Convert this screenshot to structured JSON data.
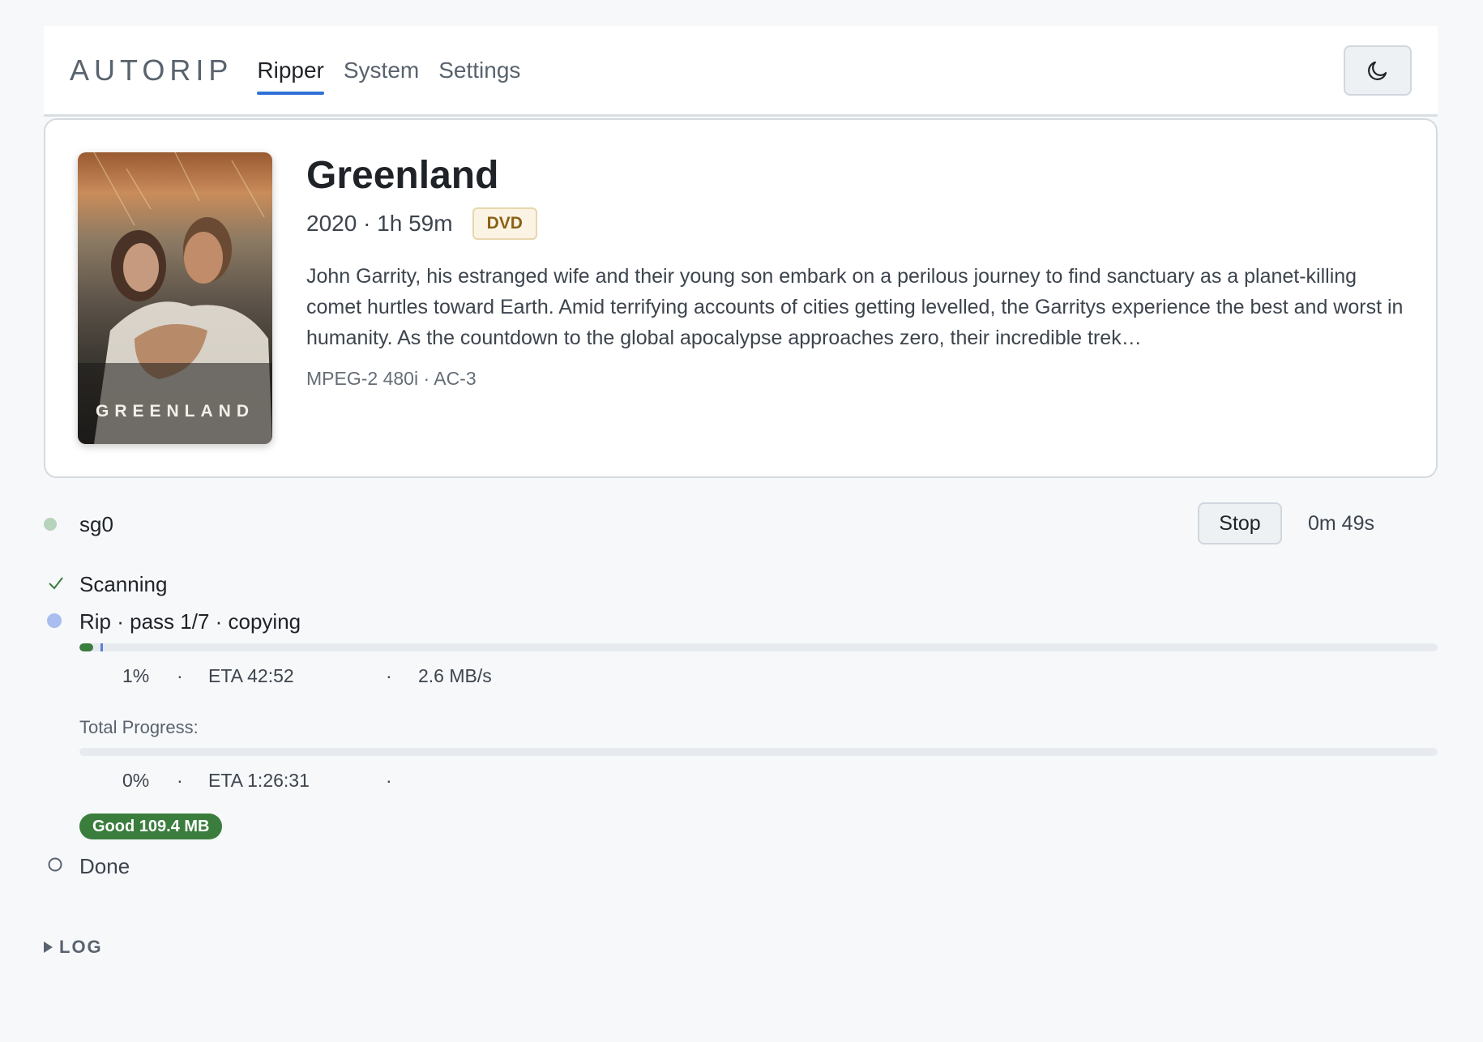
{
  "header": {
    "brand": "AUTORIP",
    "tabs": [
      {
        "label": "Ripper",
        "active": true
      },
      {
        "label": "System",
        "active": false
      },
      {
        "label": "Settings",
        "active": false
      }
    ],
    "theme_toggle_icon": "moon-icon"
  },
  "movie": {
    "poster_title": "GREENLAND",
    "title": "Greenland",
    "meta": "2020 · 1h 59m",
    "disc_type": "DVD",
    "overview": "John Garrity, his estranged wife and their young son embark on a perilous journey to find sanctuary as a planet-killing comet hurtles toward Earth. Amid terrifying accounts of cities getting levelled, the Garritys experience the best and worst in humanity. As the countdown to the global apocalypse approaches zero, their incredible trek…",
    "tech": "MPEG-2 480i · AC-3"
  },
  "drive": {
    "name": "sg0",
    "status_color": "#b7d3bb",
    "stop_label": "Stop",
    "elapsed": "0m 49s"
  },
  "steps": {
    "scanning": {
      "label": "Scanning",
      "state": "done"
    },
    "rip": {
      "label": "Rip · pass 1/7 · copying",
      "state": "active",
      "progress": 0.01,
      "percent": "1%",
      "sep1": "·",
      "eta": "ETA 42:52",
      "sep2": "·",
      "speed": "2.6 MB/s"
    },
    "total": {
      "label": "Total Progress:",
      "progress": 0,
      "percent": "0%",
      "sep1": "·",
      "eta": "ETA 1:26:31",
      "sep2": "·"
    },
    "quality_badge": "Good 109.4 MB",
    "done": {
      "label": "Done",
      "state": "pending"
    }
  },
  "log": {
    "label": "LOG"
  },
  "colors": {
    "accent": "#2f6fd6",
    "success": "#3a7d3d",
    "active_dot": "#a9bdf0"
  }
}
